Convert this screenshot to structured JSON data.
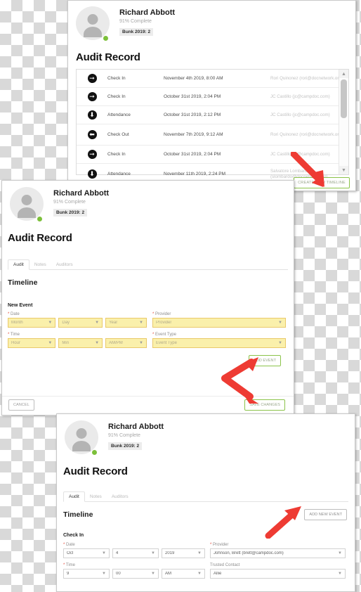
{
  "profile": {
    "name": "Richard Abbott",
    "complete": "91% Complete",
    "bunk": "Bunk 2019: 2"
  },
  "page_title": "Audit Record",
  "tabs": [
    {
      "label": "Audit",
      "active": true
    },
    {
      "label": "Notes",
      "active": false
    },
    {
      "label": "Auditors",
      "active": false
    }
  ],
  "panel_top": {
    "rows": [
      {
        "icon": "arrow-right-circle-icon",
        "type": "Check In",
        "date": "November 4th 2019, 8:00 AM",
        "user": "Rori Quinonez (rori@docnetwork.org)"
      },
      {
        "icon": "arrow-right-circle-icon",
        "type": "Check In",
        "date": "October 31st 2019, 2:04 PM",
        "user": "JC Castillo (jc@campdoc.com)"
      },
      {
        "icon": "arrow-down-circle-icon",
        "type": "Attendance",
        "date": "October 31st 2019, 2:12 PM",
        "user": "JC Castillo (jc@campdoc.com)"
      },
      {
        "icon": "arrow-left-circle-icon",
        "type": "Check Out",
        "date": "November 7th 2019, 9:12 AM",
        "user": "Rori Quinonez (rori@docnetwork.org)"
      },
      {
        "icon": "arrow-right-circle-icon",
        "type": "Check In",
        "date": "October 31st 2019, 2:04 PM",
        "user": "JC Castillo (jc@campdoc.com)"
      },
      {
        "icon": "arrow-down-circle-icon",
        "type": "Attendance",
        "date": "November 11th 2019, 2:24 PM",
        "user": "Salvatore Lombardo (slombardo@docnetwork.org)"
      }
    ],
    "create_timeline_button": "CREATE NEW TIMELINE"
  },
  "panel_mid": {
    "timeline_title": "Timeline",
    "new_event_title": "New Event",
    "date_label": "Date",
    "time_label": "Time",
    "provider_label": "Provider",
    "event_type_label": "Event Type",
    "fields": {
      "month": "Month",
      "day": "Day",
      "year": "Year",
      "hour": "Hour",
      "min": "Min",
      "ampm": "AM/PM",
      "provider": "Provider",
      "event_type": "Event Type"
    },
    "add_event_button": "ADD EVENT",
    "cancel_button": "CANCEL",
    "save_button": "SAVE CHANGES"
  },
  "panel_bottom": {
    "timeline_title": "Timeline",
    "add_new_event_button": "ADD NEW EVENT",
    "event_title": "Check In",
    "date_label": "Date",
    "time_label": "Time",
    "provider_label": "Provider",
    "trusted_contact_label": "Trusted Contact",
    "values": {
      "month": "Oct",
      "day": "4",
      "year": "2019",
      "hour": "9",
      "min": "00",
      "ampm": "AM",
      "provider": "Johnson, Brett (brett@campdoc.com)",
      "trusted_contact": "Allie"
    }
  },
  "colors": {
    "accent_green": "#8bc34a",
    "arrow_red": "#ee3b33",
    "autofill_yellow": "#faf0ab",
    "status_green": "#7cc03a"
  }
}
